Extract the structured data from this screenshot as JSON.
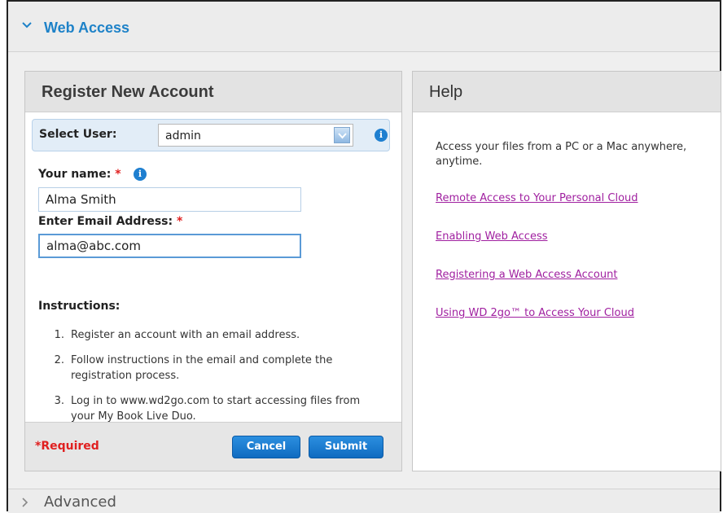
{
  "section": {
    "title": "Web Access",
    "advanced_title": "Advanced"
  },
  "register": {
    "heading": "Register New Account",
    "select_user_label": "Select User:",
    "select_user_value": "admin",
    "name_label": "Your name:",
    "name_value": "Alma Smith",
    "email_label": "Enter Email Address:",
    "email_value": "alma@abc.com",
    "required_mark": "*",
    "instructions_title": "Instructions:",
    "instructions": [
      {
        "num": "1.",
        "text": "Register an account with an email address."
      },
      {
        "num": "2.",
        "text": "Follow instructions in the email and complete the registration process."
      },
      {
        "num": "3.",
        "text": "Log in to www.wd2go.com to start accessing files from your My Book Live Duo."
      }
    ],
    "required_note": "*Required",
    "cancel_label": "Cancel",
    "submit_label": "Submit"
  },
  "help": {
    "heading": "Help",
    "text": "Access your files from a PC or a Mac anywhere, anytime.",
    "links": [
      "Remote Access to Your Personal Cloud",
      "Enabling Web Access",
      "Registering a Web Access Account",
      "Using WD 2go™ to Access Your Cloud"
    ]
  },
  "icons": {
    "info": "i",
    "info_name": "info-icon",
    "chevron": "chevron-down-icon"
  },
  "colors": {
    "accent": "#1e82c8",
    "required": "#e02020",
    "link": "#a020a0",
    "button": "#1a7ad0"
  }
}
